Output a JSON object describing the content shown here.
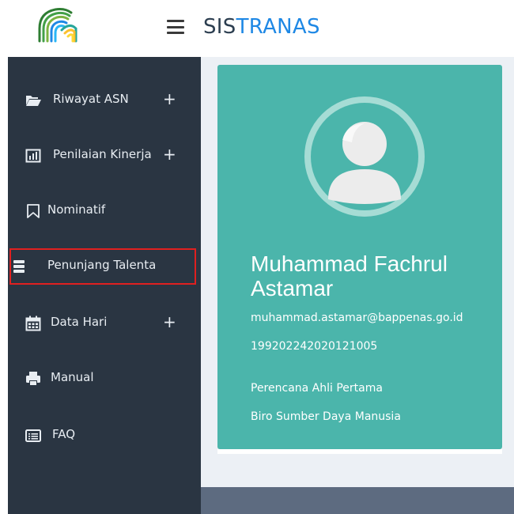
{
  "header": {
    "brand_part1": "SIS",
    "brand_part2": "TRANAS",
    "logo_icon": "sistranas-logo",
    "menu_icon": "hamburger-menu-icon"
  },
  "sidebar": {
    "items": [
      {
        "label": "Riwayat ASN",
        "icon": "folder-open-icon",
        "expandable": true,
        "expand_label": "+"
      },
      {
        "label": "Penilaian Kinerja",
        "icon": "bar-chart-icon",
        "expandable": true,
        "expand_label": "+"
      },
      {
        "label": "Nominatif",
        "icon": "bookmark-icon",
        "expandable": false
      },
      {
        "label": "Penunjang Talenta",
        "icon": "database-icon",
        "expandable": false,
        "highlighted": true
      },
      {
        "label": "Data Hari",
        "icon": "calendar-icon",
        "expandable": true,
        "expand_label": "+"
      },
      {
        "label": "Manual",
        "icon": "print-icon",
        "expandable": false
      },
      {
        "label": "FAQ",
        "icon": "list-alt-icon",
        "expandable": false
      }
    ]
  },
  "profile": {
    "avatar_icon": "user-avatar-icon",
    "name": "Muhammad Fachrul Astamar",
    "email": "muhammad.astamar@bappenas.go.id",
    "nip": "199202242020121005",
    "position": "Perencana Ahli Pertama",
    "unit": "Biro Sumber Daya Manusia"
  },
  "colors": {
    "sidebar_bg": "#2a3542",
    "card_bg": "#4bb5ab",
    "highlight_border": "#e02020",
    "brand_accent": "#1e88e5"
  }
}
